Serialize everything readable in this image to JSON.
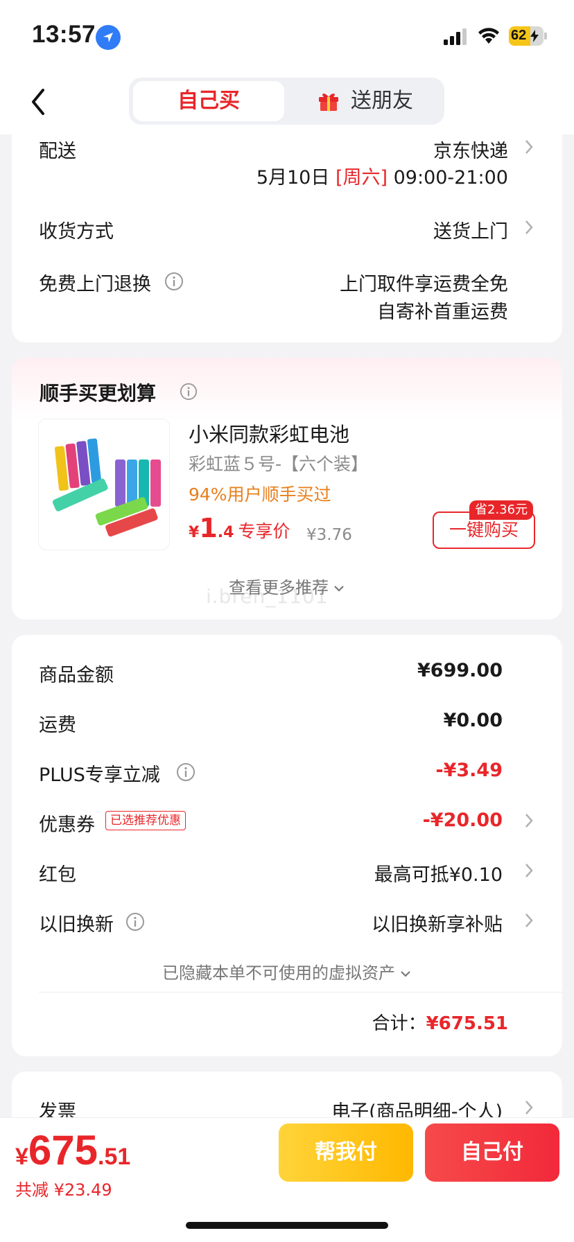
{
  "status_bar": {
    "time": "13:57",
    "battery": "62",
    "battery_fraction": 0.62,
    "icons": [
      "location-arrow-icon",
      "cellular-signal-icon",
      "wifi-icon",
      "battery-charging-icon"
    ]
  },
  "nav": {
    "tab_self": "自己买",
    "tab_gift": "送朋友",
    "icons": [
      "chevron-left-icon",
      "gift-icon"
    ]
  },
  "delivery": {
    "label": "配送",
    "carrier": "京东快递",
    "date": "5月10日",
    "weekday": "[周六]",
    "time_range": "09:00-21:00",
    "receive_label": "收货方式",
    "receive_value": "送货上门",
    "return_label": "免费上门退换",
    "return_line1": "上门取件享运费全免",
    "return_line2": "自寄补首重运费"
  },
  "recommend": {
    "title": "顺手买更划算",
    "product_name": "小米同款彩虹电池",
    "product_spec": "彩虹蓝５号-【六个装】",
    "bought_text": "94%用户顺手买过",
    "price_symbol": "¥",
    "price_int": "1",
    "price_dec": ".4",
    "price_tag": "专享价",
    "original_price": "¥3.76",
    "save_badge": "省2.36元",
    "buy_button": "一键购买",
    "more_link": "查看更多推荐",
    "watermark": "i.bren_1101"
  },
  "summary": {
    "goods_label": "商品金额",
    "goods_value": "¥699.00",
    "shipping_label": "运费",
    "shipping_value": "¥0.00",
    "plus_label": "PLUS专享立减",
    "plus_value": "-¥3.49",
    "coupon_label": "优惠券",
    "coupon_badge": "已选推荐优惠",
    "coupon_value": "-¥20.00",
    "redpacket_label": "红包",
    "redpacket_value": "最高可抵¥0.10",
    "tradein_label": "以旧换新",
    "tradein_value": "以旧换新享补贴",
    "hidden_assets": "已隐藏本单不可使用的虚拟资产",
    "total_label": "合计：",
    "total_value": "¥675.51"
  },
  "invoice": {
    "label": "发票",
    "value": "电子(商品明细-个人)"
  },
  "bottom": {
    "total_symbol": "¥",
    "total_int": "675",
    "total_dec": ".51",
    "saved": "共减 ¥23.49",
    "help_pay": "帮我付",
    "self_pay": "自己付"
  },
  "colors": {
    "accent_red": "#e8262a",
    "orange_text": "#e87f1c",
    "yellow_button": "#ffc21a",
    "battery_yellow": "#f5c518"
  }
}
